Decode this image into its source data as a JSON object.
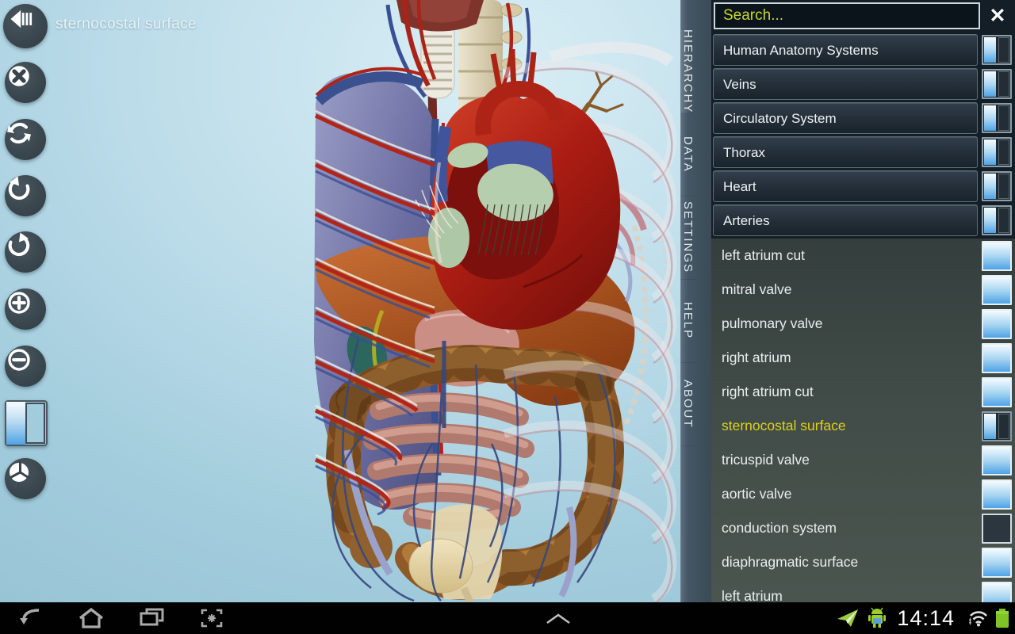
{
  "app": {
    "selected_part_title": "sternocostal surface"
  },
  "toolbar": {
    "buttons": [
      {
        "id": "back",
        "icon": "back-skip-icon"
      },
      {
        "id": "close",
        "icon": "close-circle-icon"
      },
      {
        "id": "refresh",
        "icon": "refresh-icon"
      },
      {
        "id": "rotate-left",
        "icon": "rotate-ccw-icon"
      },
      {
        "id": "rotate-right",
        "icon": "rotate-cw-icon"
      },
      {
        "id": "zoom-in",
        "icon": "zoom-in-icon"
      },
      {
        "id": "zoom-out",
        "icon": "zoom-out-icon"
      },
      {
        "id": "split-view",
        "icon": "half-filled-square-icon"
      },
      {
        "id": "pie-view",
        "icon": "pie-segments-icon"
      }
    ]
  },
  "side_tabs": [
    {
      "label": "HIERARCHY",
      "active": true
    },
    {
      "label": "DATA",
      "active": false
    },
    {
      "label": "SETTINGS",
      "active": false
    },
    {
      "label": "HELP",
      "active": false
    },
    {
      "label": "ABOUT",
      "active": false
    }
  ],
  "search": {
    "placeholder": "Search...",
    "clear_icon": "✕"
  },
  "hierarchy_list": {
    "groups": [
      {
        "label": "Human Anatomy Systems",
        "visibility": "partial"
      },
      {
        "label": "Veins",
        "visibility": "partial"
      },
      {
        "label": "Circulatory System",
        "visibility": "partial"
      },
      {
        "label": "Thorax",
        "visibility": "partial"
      },
      {
        "label": "Heart",
        "visibility": "partial"
      },
      {
        "label": "Arteries",
        "visibility": "partial"
      }
    ],
    "parts": [
      {
        "label": "left atrium cut",
        "visibility": "full",
        "selected": false
      },
      {
        "label": "mitral valve",
        "visibility": "full",
        "selected": false
      },
      {
        "label": "pulmonary valve",
        "visibility": "full",
        "selected": false
      },
      {
        "label": "right atrium",
        "visibility": "full",
        "selected": false
      },
      {
        "label": "right atrium cut",
        "visibility": "full",
        "selected": false
      },
      {
        "label": "sternocostal surface",
        "visibility": "partial",
        "selected": true
      },
      {
        "label": "tricuspid valve",
        "visibility": "full",
        "selected": false
      },
      {
        "label": "aortic valve",
        "visibility": "full",
        "selected": false
      },
      {
        "label": "conduction system",
        "visibility": "empty",
        "selected": false
      },
      {
        "label": "diaphragmatic surface",
        "visibility": "full",
        "selected": false
      },
      {
        "label": "left atrium",
        "visibility": "full",
        "selected": false
      }
    ]
  },
  "status_bar": {
    "time": "14:14"
  },
  "colors": {
    "highlight_yellow": "#ddd218",
    "search_placeholder_yellow": "#c8d72e",
    "toggle_blue": "#4fa3e6",
    "panel_bg": "#141e27",
    "parts_list_bg": "#424d49",
    "tabstrip_bg": "#42525f",
    "canvas_light": "#d9eef5",
    "canvas_dark": "#93c0d3",
    "battery_green": "#7ec425"
  }
}
